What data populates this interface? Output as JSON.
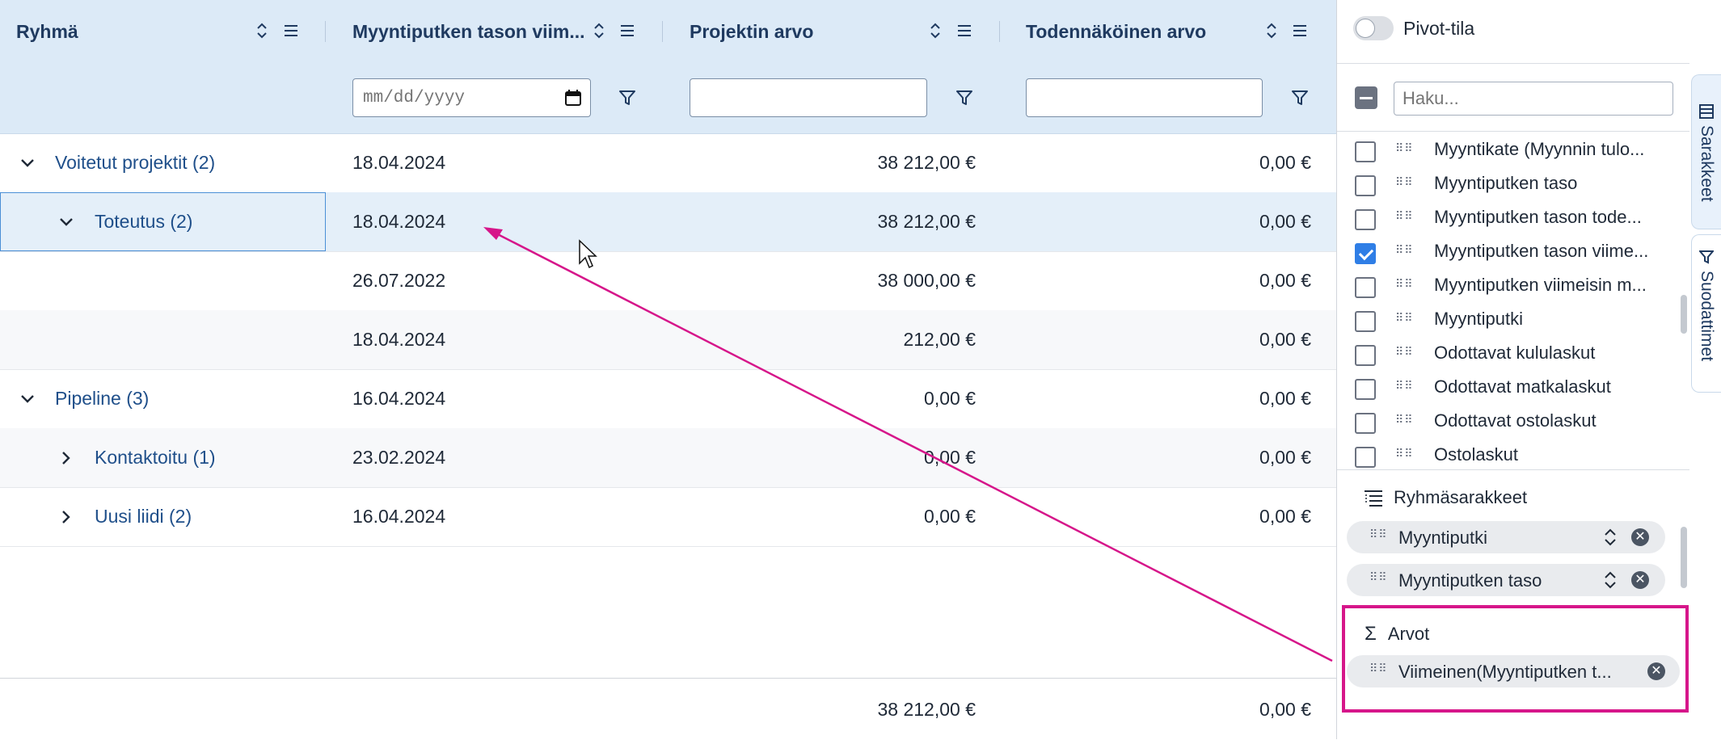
{
  "colors": {
    "accent": "#2f7ee6",
    "highlight": "#d6168a",
    "header_bg": "#dceaf7"
  },
  "grid": {
    "columns": [
      {
        "title": "Ryhmä"
      },
      {
        "title": "Myyntiputken tason viim..."
      },
      {
        "title": "Projektin arvo"
      },
      {
        "title": "Todennäköinen arvo"
      }
    ],
    "filters": {
      "date_placeholder": "mm/dd/yyyy",
      "value_placeholder": "",
      "prob_placeholder": ""
    },
    "rows": [
      {
        "group": "Voitetut projektit (2)",
        "date": "18.04.2024",
        "value": "38 212,00 €",
        "prob": "0,00 €"
      },
      {
        "group": "Toteutus (2)",
        "date": "18.04.2024",
        "value": "38 212,00 €",
        "prob": "0,00 €"
      },
      {
        "group": "",
        "date": "26.07.2022",
        "value": "38 000,00 €",
        "prob": "0,00 €"
      },
      {
        "group": "",
        "date": "18.04.2024",
        "value": "212,00 €",
        "prob": "0,00 €"
      },
      {
        "group": "Pipeline (3)",
        "date": "16.04.2024",
        "value": "0,00 €",
        "prob": "0,00 €"
      },
      {
        "group": "Kontaktoitu (1)",
        "date": "23.02.2024",
        "value": "0,00 €",
        "prob": "0,00 €"
      },
      {
        "group": "Uusi liidi (2)",
        "date": "16.04.2024",
        "value": "0,00 €",
        "prob": "0,00 €"
      }
    ],
    "totals": {
      "value": "38 212,00 €",
      "prob": "0,00 €"
    }
  },
  "panel": {
    "pivot_label": "Pivot-tila",
    "search_placeholder": "Haku...",
    "columns": [
      {
        "label": "Myyntikate (Myynnin tulo...",
        "checked": false
      },
      {
        "label": "Myyntiputken taso",
        "checked": false
      },
      {
        "label": "Myyntiputken tason tode...",
        "checked": false
      },
      {
        "label": "Myyntiputken tason viime...",
        "checked": true
      },
      {
        "label": "Myyntiputken viimeisin m...",
        "checked": false
      },
      {
        "label": "Myyntiputki",
        "checked": false
      },
      {
        "label": "Odottavat kululaskut",
        "checked": false
      },
      {
        "label": "Odottavat matkalaskut",
        "checked": false
      },
      {
        "label": "Odottavat ostolaskut",
        "checked": false
      },
      {
        "label": "Ostolaskut",
        "checked": false
      }
    ],
    "group_section": {
      "title": "Ryhmäsarakkeet",
      "chips": [
        "Myyntiputki",
        "Myyntiputken taso"
      ]
    },
    "values_section": {
      "icon": "Σ",
      "title": "Arvot",
      "chips": [
        "Viimeinen(Myyntiputken t..."
      ]
    },
    "side_tabs": [
      "Sarakkeet",
      "Suodattimet"
    ]
  }
}
